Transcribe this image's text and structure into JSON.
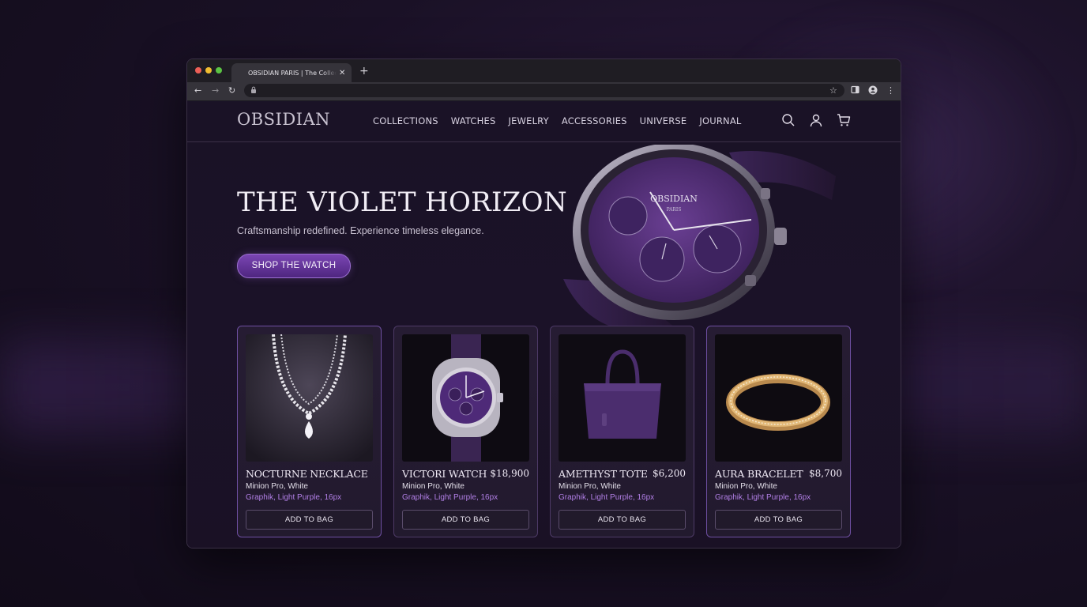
{
  "browser": {
    "tab_title": "OBSIDIAN PARIS | The Collection",
    "tab_close": "✕",
    "new_tab": "+",
    "back": "←",
    "forward": "→",
    "reload": "↻",
    "star": "☆",
    "menu": "⋮"
  },
  "site": {
    "logo": "OBSIDIAN",
    "nav": [
      "COLLECTIONS",
      "WATCHES",
      "JEWELRY",
      "ACCESSORIES",
      "UNIVERSE",
      "JOURNAL"
    ],
    "hero": {
      "title": "THE VIOLET HORIZON",
      "subtitle": "Craftsmanship redefined. Experience timeless elegance.",
      "cta": "SHOP THE WATCH",
      "watch_brand": "OBSIDIAN",
      "watch_sub": "PARIS"
    },
    "products": [
      {
        "name": "NOCTURNE NECKLACE",
        "price": "",
        "line1": "Minion Pro, White",
        "line2": "Graphik, Light Purple, 16px",
        "button": "ADD TO BAG",
        "icon": "necklace-image"
      },
      {
        "name": "VICTORI WATCH",
        "price": "$18,900",
        "line1": "Minion Pro, White",
        "line2": "Graphik, Light Purple, 16px",
        "button": "ADD TO BAG",
        "icon": "watch-image"
      },
      {
        "name": "AMETHYST TOTE",
        "price": "$6,200",
        "line1": "Minion Pro, White",
        "line2": "Graphik, Light Purple, 16px",
        "button": "ADD TO BAG",
        "icon": "tote-image"
      },
      {
        "name": "AURA BRACELET",
        "price": "$8,700",
        "line1": "Minion Pro, White",
        "line2": "Graphik, Light Purple, 16px",
        "button": "ADD TO BAG",
        "icon": "bracelet-image"
      }
    ]
  },
  "colors": {
    "accent": "#7a45b3",
    "light_purple": "#b27fe6",
    "background": "#1a1226"
  }
}
